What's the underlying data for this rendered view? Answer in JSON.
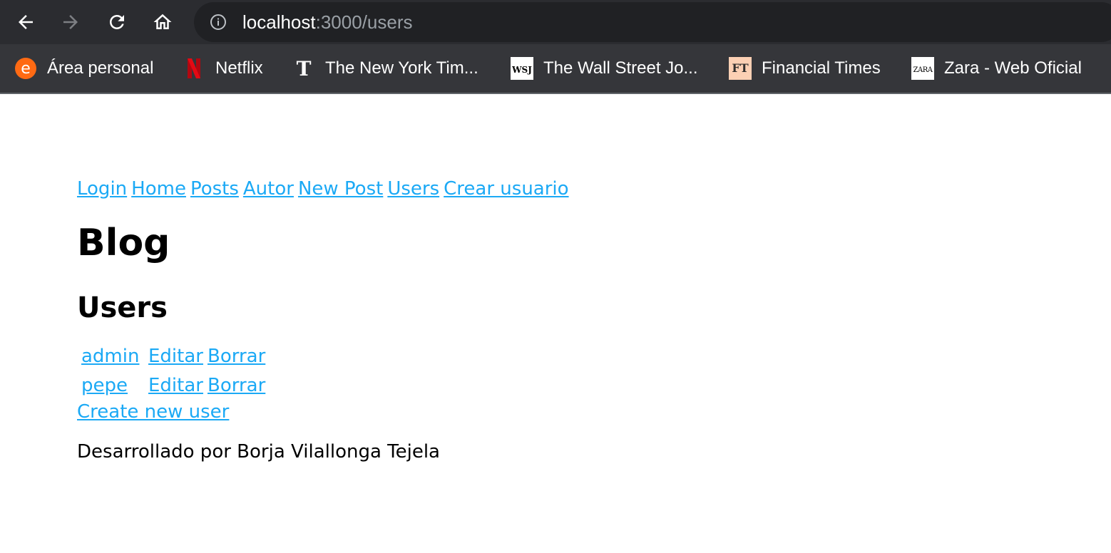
{
  "browser": {
    "url_host": "localhost",
    "url_path": ":3000/users",
    "bookmarks": [
      {
        "label": "Área personal",
        "icon": "e-orange-circle-icon",
        "color": "#ff6a13",
        "glyph": "e"
      },
      {
        "label": "Netflix",
        "icon": "netflix-icon",
        "color": "#e50914",
        "glyph": ""
      },
      {
        "label": "The New York Tim...",
        "icon": "nyt-icon",
        "color": "#ffffff",
        "glyph": "𝕿"
      },
      {
        "label": "The Wall Street Jo...",
        "icon": "wsj-icon",
        "color": "#ffffff",
        "glyph": "WSJ"
      },
      {
        "label": "Financial Times",
        "icon": "ft-icon",
        "color": "#fcd0b4",
        "glyph": "FT"
      },
      {
        "label": "Zara - Web Oficial",
        "icon": "zara-icon",
        "color": "#ffffff",
        "glyph": "ZARA"
      }
    ]
  },
  "nav": {
    "links": [
      "Login",
      "Home",
      "Posts",
      "Autor",
      "New Post",
      "Users",
      "Crear usuario"
    ]
  },
  "page": {
    "title": "Blog",
    "section": "Users",
    "users": [
      {
        "name": "admin",
        "edit": "Editar",
        "delete": "Borrar"
      },
      {
        "name": "pepe",
        "edit": "Editar",
        "delete": "Borrar"
      }
    ],
    "create_link": "Create new user",
    "footer": "Desarrollado por Borja Vilallonga Tejela"
  },
  "colors": {
    "link": "#1ba9f5",
    "toolbar": "#2b2c30",
    "bookmarks_bar": "#35363a"
  }
}
